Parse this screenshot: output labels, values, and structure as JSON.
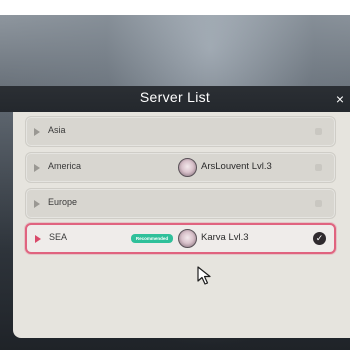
{
  "dialog": {
    "title": "Server List",
    "close_glyph": "×"
  },
  "servers": [
    {
      "name": "Asia",
      "player": "",
      "recommended": false,
      "selected": false
    },
    {
      "name": "America",
      "player": "ArsLouvent  Lvl.3",
      "recommended": false,
      "selected": false
    },
    {
      "name": "Europe",
      "player": "",
      "recommended": false,
      "selected": false
    },
    {
      "name": "SEA",
      "player": "Karva  Lvl.3",
      "recommended": true,
      "selected": true
    }
  ],
  "badge": {
    "recommended_label": "Recommended"
  },
  "check_glyph": "✓",
  "colors": {
    "selection_border": "#e0637f",
    "recommended_badge": "#2fc09a",
    "panel_background": "#e6e4de",
    "header_background": "#2b2f34"
  },
  "icons": {
    "close": "close-icon",
    "row_marker": "play-arrow-icon",
    "avatar": "character-avatar-icon",
    "selected": "checkmark-icon",
    "cursor": "mouse-cursor-icon"
  }
}
